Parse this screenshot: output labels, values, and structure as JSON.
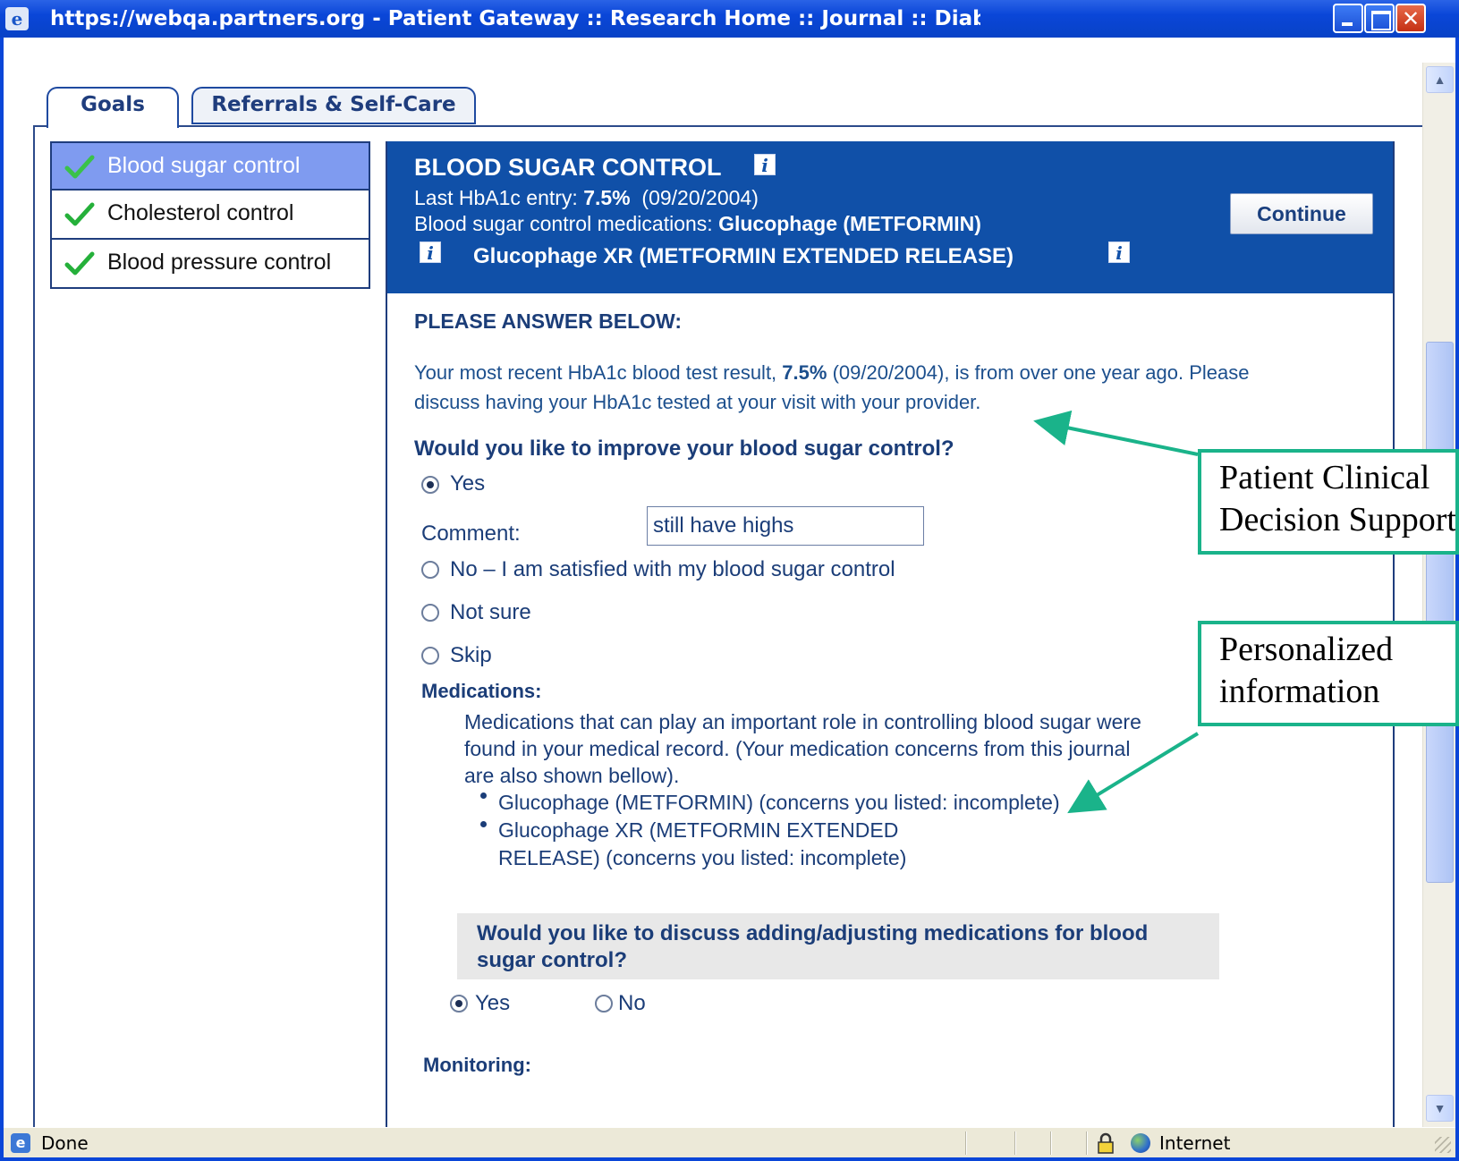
{
  "window": {
    "title": "https://webqa.partners.org - Patient Gateway :: Research Home :: Journal :: Diabetes Care - Microsoft Internet E...",
    "close_glyph": "✕"
  },
  "tabs": [
    {
      "label": "Goals",
      "active": true
    },
    {
      "label": "Referrals & Self-Care",
      "active": false
    }
  ],
  "sidebar": {
    "items": [
      {
        "label": "Blood sugar control",
        "selected": true,
        "icon": "check-icon"
      },
      {
        "label": "Cholesterol control",
        "selected": false,
        "icon": "check-icon"
      },
      {
        "label": "Blood pressure control",
        "selected": false,
        "icon": "check-icon"
      }
    ]
  },
  "header": {
    "title": "BLOOD SUGAR CONTROL",
    "last_entry_label": "Last HbA1c entry: ",
    "last_entry_value": "7.5%",
    "last_entry_date": "(09/20/2004)",
    "meds_label": "Blood sugar control medications: ",
    "med1": "Glucophage (METFORMIN)",
    "med2": "Glucophage XR (METFORMIN EXTENDED RELEASE)",
    "continue_label": "Continue",
    "info_glyph": "i"
  },
  "content": {
    "please": "PLEASE ANSWER BELOW:",
    "notice_before": "Your most recent HbA1c blood test result, ",
    "notice_value": "7.5%",
    "notice_after": " (09/20/2004), is from over one year ago. Please discuss having your HbA1c tested at your visit with your provider.",
    "question": "Would you like to improve your blood sugar control?",
    "options": {
      "yes": "Yes",
      "no": "No – I am satisfied with my blood sugar control",
      "not_sure": "Not sure",
      "skip": "Skip"
    },
    "selected_option": "Yes",
    "comment_label": "Comment:",
    "comment_value": "still have highs",
    "medications_heading": "Medications:",
    "medications_text": "Medications that can play an important role in controlling blood sugar were found in your medical record. (Your medication concerns from this journal are also shown bellow).",
    "med_items": [
      "Glucophage (METFORMIN)  (concerns you listed: incomplete)",
      "Glucophage XR (METFORMIN EXTENDED",
      "RELEASE)  (concerns you listed: incomplete)"
    ],
    "discuss_question": "Would you like to discuss adding/adjusting medications for blood sugar control?",
    "discuss_yes": "Yes",
    "discuss_no": "No",
    "discuss_selected": "Yes",
    "monitoring_heading": "Monitoring:"
  },
  "callouts": {
    "cds": [
      "Patient Clinical",
      "Decision Support"
    ],
    "personalized": [
      "Personalized",
      "information"
    ],
    "border_color": "#1ab38a"
  },
  "status_bar": {
    "status": "Done",
    "zone": "Internet"
  },
  "colors": {
    "header_bg": "#1050a8",
    "selected_sidebar": "#7f9bf0",
    "titlebar": "#0a46d8",
    "text_blue": "#1b3d78"
  }
}
